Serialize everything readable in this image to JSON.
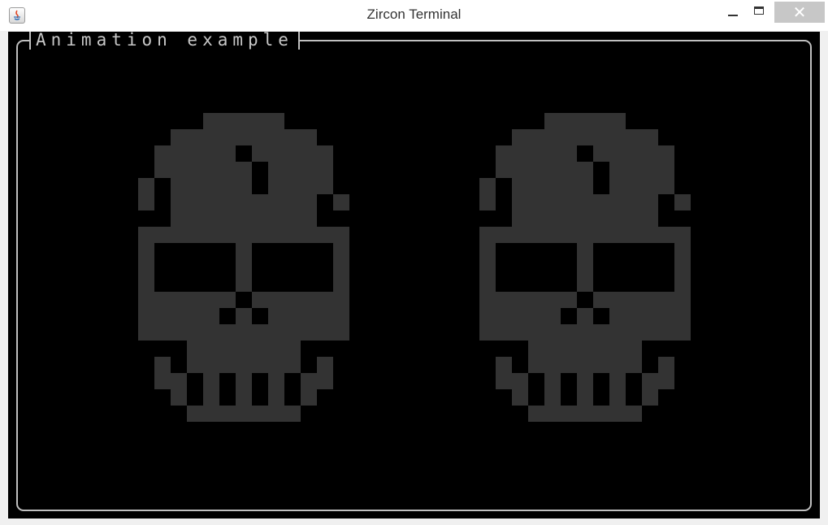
{
  "window": {
    "title": "Zircon Terminal",
    "close_glyph": "✕"
  },
  "terminal": {
    "panel_title": "Animation example",
    "colors": {
      "background": "#000000",
      "skull": "#333333",
      "frame": "#c0c0c0",
      "text": "#c8c8c8"
    }
  },
  "icons": {
    "app": "java-icon",
    "minimize": "minimize-icon",
    "maximize": "maximize-icon",
    "close": "close-icon"
  }
}
